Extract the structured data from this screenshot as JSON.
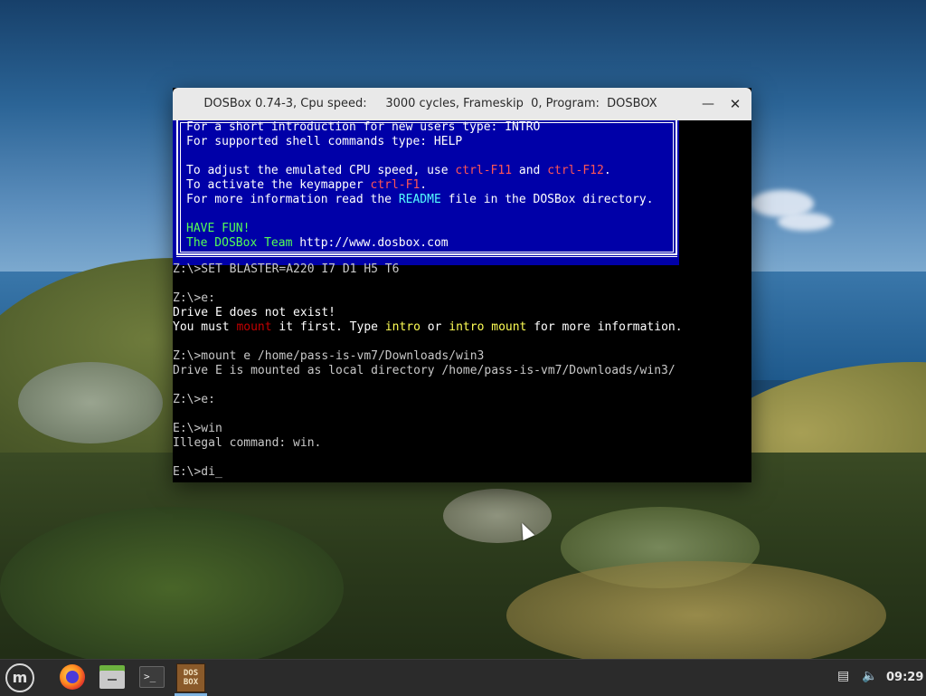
{
  "window": {
    "title": "DOSBox 0.74-3, Cpu speed:     3000 cycles, Frameskip  0, Program:  DOSBOX",
    "minimize_label": "—",
    "close_label": "✕"
  },
  "banner_lines": [
    [
      {
        "text": "For a short introduction for new users type: INTRO",
        "color": "white"
      }
    ],
    [
      {
        "text": "For supported shell commands type: HELP",
        "color": "white"
      }
    ],
    [
      {
        "text": "",
        "color": "white"
      }
    ],
    [
      {
        "text": "To adjust the emulated CPU speed, use ",
        "color": "white"
      },
      {
        "text": "ctrl-F11",
        "color": "red"
      },
      {
        "text": " and ",
        "color": "white"
      },
      {
        "text": "ctrl-F12",
        "color": "red"
      },
      {
        "text": ".",
        "color": "white"
      }
    ],
    [
      {
        "text": "To activate the keymapper ",
        "color": "white"
      },
      {
        "text": "ctrl-F1",
        "color": "red"
      },
      {
        "text": ".",
        "color": "white"
      }
    ],
    [
      {
        "text": "For more information read the ",
        "color": "white"
      },
      {
        "text": "README",
        "color": "cyan"
      },
      {
        "text": " file in the DOSBox directory.",
        "color": "white"
      }
    ],
    [
      {
        "text": "",
        "color": "white"
      }
    ],
    [
      {
        "text": "HAVE FUN!",
        "color": "green"
      }
    ],
    [
      {
        "text": "The DOSBox Team ",
        "color": "green"
      },
      {
        "text": "http://www.dosbox.com",
        "color": "white"
      }
    ]
  ],
  "console_lines": [
    [
      {
        "text": "Z:\\>SET BLASTER=A220 I7 D1 H5 T6",
        "color": "lgray"
      }
    ],
    [
      {
        "text": "",
        "color": "lgray"
      }
    ],
    [
      {
        "text": "Z:\\>e:",
        "color": "lgray"
      }
    ],
    [
      {
        "text": "Drive E does not exist!",
        "color": "white"
      }
    ],
    [
      {
        "text": "You must ",
        "color": "white"
      },
      {
        "text": "mount",
        "color": "dred"
      },
      {
        "text": " it first. Type ",
        "color": "white"
      },
      {
        "text": "intro",
        "color": "yellow"
      },
      {
        "text": " or ",
        "color": "white"
      },
      {
        "text": "intro mount",
        "color": "yellow"
      },
      {
        "text": " for more information.",
        "color": "white"
      }
    ],
    [
      {
        "text": "",
        "color": "lgray"
      }
    ],
    [
      {
        "text": "Z:\\>mount e /home/pass-is-vm7/Downloads/win3",
        "color": "lgray"
      }
    ],
    [
      {
        "text": "Drive E is mounted as local directory /home/pass-is-vm7/Downloads/win3/",
        "color": "lgray"
      }
    ],
    [
      {
        "text": "",
        "color": "lgray"
      }
    ],
    [
      {
        "text": "Z:\\>e:",
        "color": "lgray"
      }
    ],
    [
      {
        "text": "",
        "color": "lgray"
      }
    ],
    [
      {
        "text": "E:\\>win",
        "color": "lgray"
      }
    ],
    [
      {
        "text": "Illegal command: win.",
        "color": "lgray"
      }
    ],
    [
      {
        "text": "",
        "color": "lgray"
      }
    ]
  ],
  "prompt": {
    "text": "E:\\>di",
    "cursor": "_"
  },
  "taskbar": {
    "menu_icon": "mint-menu-icon",
    "menu_glyph": "m",
    "apps": [
      {
        "name": "firefox-icon"
      },
      {
        "name": "files-icon"
      },
      {
        "name": "terminal-icon",
        "glyph": ">_"
      },
      {
        "name": "dosbox-icon",
        "label_top": "DOS",
        "label_bottom": "BOX",
        "active": true
      }
    ],
    "tray": {
      "network_glyph": "▤",
      "volume_glyph": "🔈",
      "clock": "09:29"
    }
  },
  "colors": {
    "white": "#ffffff",
    "red": "#ff5555",
    "cyan": "#55ffff",
    "yellow": "#ffff55",
    "lgray": "#c8c8c8",
    "dred": "#c40000",
    "green": "#55ff55",
    "banner_bg": "#0000a8"
  }
}
